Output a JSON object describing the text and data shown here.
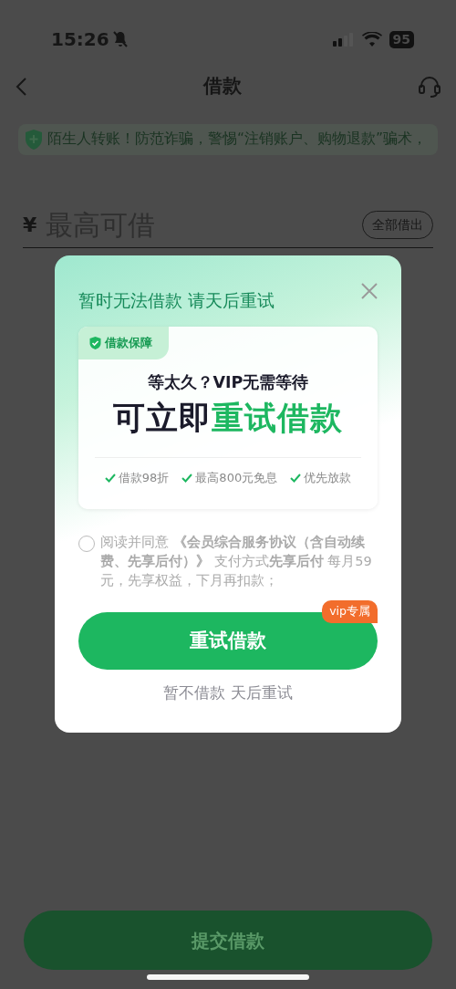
{
  "status_bar": {
    "time": "15:26",
    "battery": "95"
  },
  "nav": {
    "title": "借款"
  },
  "notice": {
    "text": "陌生人转账！防范诈骗，警惕“注销账户、购物退款”骗术，"
  },
  "amount": {
    "currency": "¥",
    "placeholder": "最高可借",
    "all_button": "全部借出"
  },
  "dialog": {
    "title": "暂时无法借款 请天后重试",
    "card": {
      "tag": "借款保障",
      "subtitle": "等太久？VIP无需等待",
      "headline_plain": "可立即",
      "headline_highlight": "重试借款",
      "benefits": [
        "借款98折",
        "最高800元免息",
        "优先放款"
      ]
    },
    "agreement": {
      "checked": false,
      "text": "阅读并同意 **《会员综合服务协议（含自动续费、先享后付）》** 支付方式**先享后付** 每月59元，先享权益，下月再扣款；"
    },
    "primary_button": "重试借款",
    "badge": "vip专属",
    "secondary": "暂不借款 天后重试"
  },
  "submit_button": "提交借款"
}
